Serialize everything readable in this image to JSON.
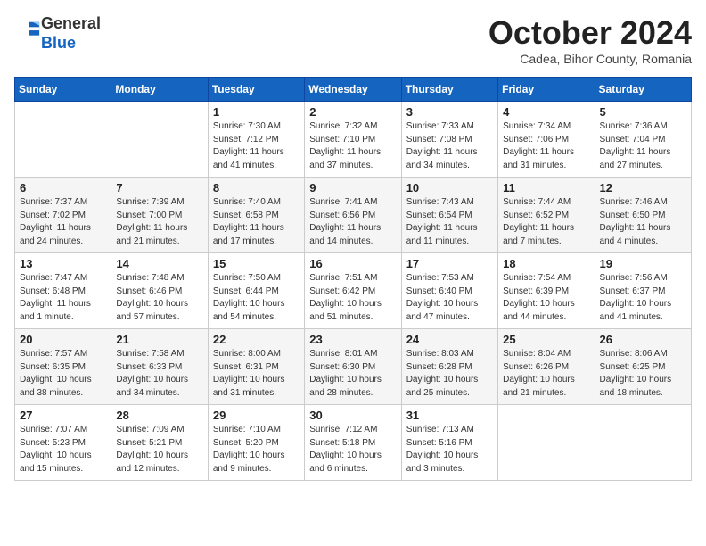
{
  "header": {
    "logo_line1": "General",
    "logo_line2": "Blue",
    "month_title": "October 2024",
    "subtitle": "Cadea, Bihor County, Romania"
  },
  "days_of_week": [
    "Sunday",
    "Monday",
    "Tuesday",
    "Wednesday",
    "Thursday",
    "Friday",
    "Saturday"
  ],
  "weeks": [
    [
      {
        "day": "",
        "info": ""
      },
      {
        "day": "",
        "info": ""
      },
      {
        "day": "1",
        "info": "Sunrise: 7:30 AM\nSunset: 7:12 PM\nDaylight: 11 hours and 41 minutes."
      },
      {
        "day": "2",
        "info": "Sunrise: 7:32 AM\nSunset: 7:10 PM\nDaylight: 11 hours and 37 minutes."
      },
      {
        "day": "3",
        "info": "Sunrise: 7:33 AM\nSunset: 7:08 PM\nDaylight: 11 hours and 34 minutes."
      },
      {
        "day": "4",
        "info": "Sunrise: 7:34 AM\nSunset: 7:06 PM\nDaylight: 11 hours and 31 minutes."
      },
      {
        "day": "5",
        "info": "Sunrise: 7:36 AM\nSunset: 7:04 PM\nDaylight: 11 hours and 27 minutes."
      }
    ],
    [
      {
        "day": "6",
        "info": "Sunrise: 7:37 AM\nSunset: 7:02 PM\nDaylight: 11 hours and 24 minutes."
      },
      {
        "day": "7",
        "info": "Sunrise: 7:39 AM\nSunset: 7:00 PM\nDaylight: 11 hours and 21 minutes."
      },
      {
        "day": "8",
        "info": "Sunrise: 7:40 AM\nSunset: 6:58 PM\nDaylight: 11 hours and 17 minutes."
      },
      {
        "day": "9",
        "info": "Sunrise: 7:41 AM\nSunset: 6:56 PM\nDaylight: 11 hours and 14 minutes."
      },
      {
        "day": "10",
        "info": "Sunrise: 7:43 AM\nSunset: 6:54 PM\nDaylight: 11 hours and 11 minutes."
      },
      {
        "day": "11",
        "info": "Sunrise: 7:44 AM\nSunset: 6:52 PM\nDaylight: 11 hours and 7 minutes."
      },
      {
        "day": "12",
        "info": "Sunrise: 7:46 AM\nSunset: 6:50 PM\nDaylight: 11 hours and 4 minutes."
      }
    ],
    [
      {
        "day": "13",
        "info": "Sunrise: 7:47 AM\nSunset: 6:48 PM\nDaylight: 11 hours and 1 minute."
      },
      {
        "day": "14",
        "info": "Sunrise: 7:48 AM\nSunset: 6:46 PM\nDaylight: 10 hours and 57 minutes."
      },
      {
        "day": "15",
        "info": "Sunrise: 7:50 AM\nSunset: 6:44 PM\nDaylight: 10 hours and 54 minutes."
      },
      {
        "day": "16",
        "info": "Sunrise: 7:51 AM\nSunset: 6:42 PM\nDaylight: 10 hours and 51 minutes."
      },
      {
        "day": "17",
        "info": "Sunrise: 7:53 AM\nSunset: 6:40 PM\nDaylight: 10 hours and 47 minutes."
      },
      {
        "day": "18",
        "info": "Sunrise: 7:54 AM\nSunset: 6:39 PM\nDaylight: 10 hours and 44 minutes."
      },
      {
        "day": "19",
        "info": "Sunrise: 7:56 AM\nSunset: 6:37 PM\nDaylight: 10 hours and 41 minutes."
      }
    ],
    [
      {
        "day": "20",
        "info": "Sunrise: 7:57 AM\nSunset: 6:35 PM\nDaylight: 10 hours and 38 minutes."
      },
      {
        "day": "21",
        "info": "Sunrise: 7:58 AM\nSunset: 6:33 PM\nDaylight: 10 hours and 34 minutes."
      },
      {
        "day": "22",
        "info": "Sunrise: 8:00 AM\nSunset: 6:31 PM\nDaylight: 10 hours and 31 minutes."
      },
      {
        "day": "23",
        "info": "Sunrise: 8:01 AM\nSunset: 6:30 PM\nDaylight: 10 hours and 28 minutes."
      },
      {
        "day": "24",
        "info": "Sunrise: 8:03 AM\nSunset: 6:28 PM\nDaylight: 10 hours and 25 minutes."
      },
      {
        "day": "25",
        "info": "Sunrise: 8:04 AM\nSunset: 6:26 PM\nDaylight: 10 hours and 21 minutes."
      },
      {
        "day": "26",
        "info": "Sunrise: 8:06 AM\nSunset: 6:25 PM\nDaylight: 10 hours and 18 minutes."
      }
    ],
    [
      {
        "day": "27",
        "info": "Sunrise: 7:07 AM\nSunset: 5:23 PM\nDaylight: 10 hours and 15 minutes."
      },
      {
        "day": "28",
        "info": "Sunrise: 7:09 AM\nSunset: 5:21 PM\nDaylight: 10 hours and 12 minutes."
      },
      {
        "day": "29",
        "info": "Sunrise: 7:10 AM\nSunset: 5:20 PM\nDaylight: 10 hours and 9 minutes."
      },
      {
        "day": "30",
        "info": "Sunrise: 7:12 AM\nSunset: 5:18 PM\nDaylight: 10 hours and 6 minutes."
      },
      {
        "day": "31",
        "info": "Sunrise: 7:13 AM\nSunset: 5:16 PM\nDaylight: 10 hours and 3 minutes."
      },
      {
        "day": "",
        "info": ""
      },
      {
        "day": "",
        "info": ""
      }
    ]
  ]
}
